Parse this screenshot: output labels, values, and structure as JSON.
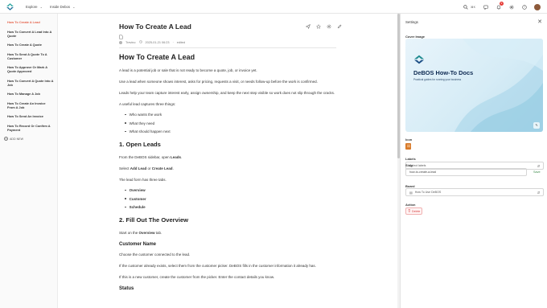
{
  "topbar": {
    "nav_explore": "Explore",
    "nav_inside": "Inside Debos",
    "search_shortcut": "⌘K",
    "notification_count": "9",
    "icons": [
      "search-icon",
      "message-icon",
      "bell-icon",
      "gear-icon",
      "help-icon",
      "avatar"
    ]
  },
  "sidebar": {
    "items": [
      {
        "label": "How To Create A Lead",
        "active": true
      },
      {
        "label": "How To Convert A Lead Into A Quote"
      },
      {
        "label": "How To Create A Quote"
      },
      {
        "label": "How To Send A Quote To A Customer"
      },
      {
        "label": "How To Approve Or Mark A Quote Approved"
      },
      {
        "label": "How To Convert A Quote Into A Job"
      },
      {
        "label": "How To Manage A Job"
      },
      {
        "label": "How To Create An Invoice From A Job"
      },
      {
        "label": "How To Send An Invoice"
      },
      {
        "label": "How To Record Or Confirm A Payment"
      }
    ],
    "add_label": "ADD NEW"
  },
  "doc": {
    "title": "How To Create A Lead",
    "meta_author": "Trevino",
    "meta_date": "2025-01-21 06:23",
    "meta_status": "edited",
    "heading": "How To Create A Lead",
    "p1": "A lead is a potential job or sale that is not ready to become a quote, job, or invoice yet.",
    "p2": "Use a lead when someone shows interest, asks for pricing, requests a visit, or needs follow-up before the work is confirmed.",
    "p3": "Leads help your team capture interest early, assign ownership, and keep the next step visible so work does not slip through the cracks.",
    "p4": "A useful lead captures three things:",
    "bullets": [
      "Who wants the work",
      "What they need",
      "What should happen next"
    ],
    "s1_heading": "1. Open Leads",
    "s1_p1_pre": "From the DeBOS sidebar, open ",
    "s1_p1_bold": "Leads",
    "s1_p1_post": ".",
    "s1_p2_pre": "Select ",
    "s1_p2_bold1": "Add Lead",
    "s1_p2_mid": " or ",
    "s1_p2_bold2": "Create Lead",
    "s1_p2_post": ".",
    "s1_p3": "The lead form has three tabs.",
    "tabs": [
      "Overview",
      "Customer",
      "Schedule"
    ],
    "s2_heading": "2. Fill Out The Overview",
    "s2_p1_pre": "Start on the ",
    "s2_p1_bold": "Overview",
    "s2_p1_post": " tab.",
    "s3_heading": "Customer Name",
    "s3_p1": "Choose the customer connected to the lead.",
    "s3_p2": "If the customer already exists, select them from the customer picker. DeBOS fills in the customer information it already has.",
    "s3_p3": "If this is a new customer, create the customer from the picker. Enter the contact details you know.",
    "s4_heading": "Status"
  },
  "settings": {
    "title": "Settings",
    "cover_label": "Cover Image",
    "cover_title": "DeBOS How-To Docs",
    "cover_subtitle": "Practical guides for running your business",
    "icon_label": "Icon",
    "labels_label": "Labels",
    "labels_placeholder": "Select labels",
    "slug_label": "Slug",
    "slug_value": "how-to-create-a-lead",
    "save_label": "Save",
    "board_label": "Board",
    "board_value": "How To Use DeBOS",
    "action_label": "Action",
    "delete_label": "Delete"
  },
  "colors": {
    "accent": "#e5634b",
    "save": "#3c8a4a",
    "delete": "#d84040",
    "cover_text": "#0e2a52"
  }
}
